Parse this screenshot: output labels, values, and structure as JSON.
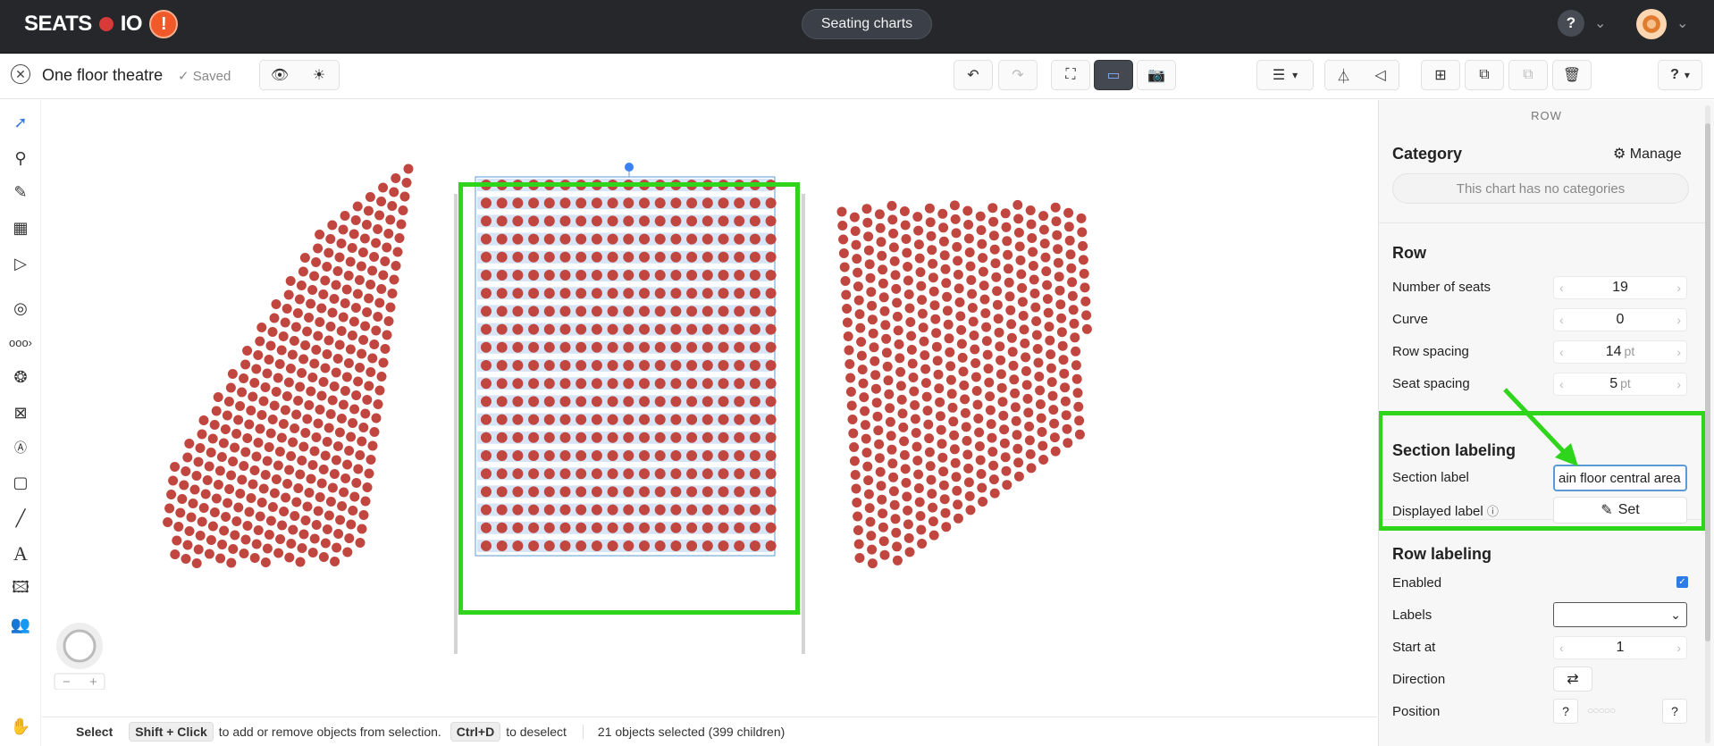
{
  "topbar": {
    "logo_left": "SEATS",
    "logo_right": "IO",
    "alert_glyph": "!",
    "center_button": "Seating charts",
    "help": "?"
  },
  "toolbar": {
    "chart_title": "One floor theatre",
    "saved_status": "Saved",
    "help": "?"
  },
  "statusbar": {
    "mode": "Select",
    "key1": "Shift + Click",
    "text1": "to add or remove objects from selection.",
    "key2": "Ctrl+D",
    "text2": "to deselect",
    "selection": "21 objects selected (399 children)"
  },
  "panel": {
    "heading": "ROW",
    "category": {
      "title": "Category",
      "manage": "Manage",
      "empty": "This chart has no categories"
    },
    "row": {
      "title": "Row",
      "fields": [
        {
          "label": "Number of seats",
          "value": "19",
          "unit": ""
        },
        {
          "label": "Curve",
          "value": "0",
          "unit": ""
        },
        {
          "label": "Row spacing",
          "value": "14",
          "unit": "pt"
        },
        {
          "label": "Seat spacing",
          "value": "5",
          "unit": "pt"
        }
      ]
    },
    "section_labeling": {
      "title": "Section labeling",
      "section_label": "Section label",
      "section_value": "ain floor central area",
      "displayed_label": "Displayed label",
      "set_button": "Set"
    },
    "row_labeling": {
      "title": "Row labeling",
      "enabled": "Enabled",
      "labels": "Labels",
      "start_at": "Start at",
      "start_value": "1",
      "direction": "Direction",
      "position": "Position",
      "pos_left": "?",
      "pos_right": "?"
    }
  },
  "colors": {
    "seat": "#c0463f",
    "highlight": "#2fd51a",
    "selection": "#5b9bd5",
    "topbar": "#25272b"
  }
}
